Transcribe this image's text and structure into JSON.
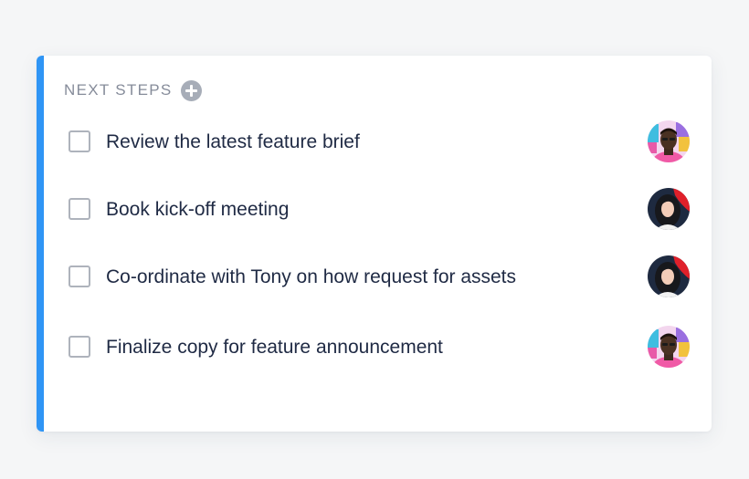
{
  "section": {
    "title": "NEXT STEPS",
    "add_icon": "plus-circle-icon"
  },
  "tasks": [
    {
      "label": "Review the latest feature brief",
      "checked": false,
      "assignee": "avatar-man"
    },
    {
      "label": "Book kick-off meeting",
      "checked": false,
      "assignee": "avatar-woman"
    },
    {
      "label": "Co-ordinate with Tony on how request for assets",
      "checked": false,
      "assignee": "avatar-woman"
    },
    {
      "label": "Finalize copy for feature announcement",
      "checked": false,
      "assignee": "avatar-man"
    }
  ],
  "colors": {
    "accent": "#2f95f5",
    "title": "#868c9a",
    "text": "#1f2a44",
    "checkbox_border": "#aeb3bc"
  }
}
